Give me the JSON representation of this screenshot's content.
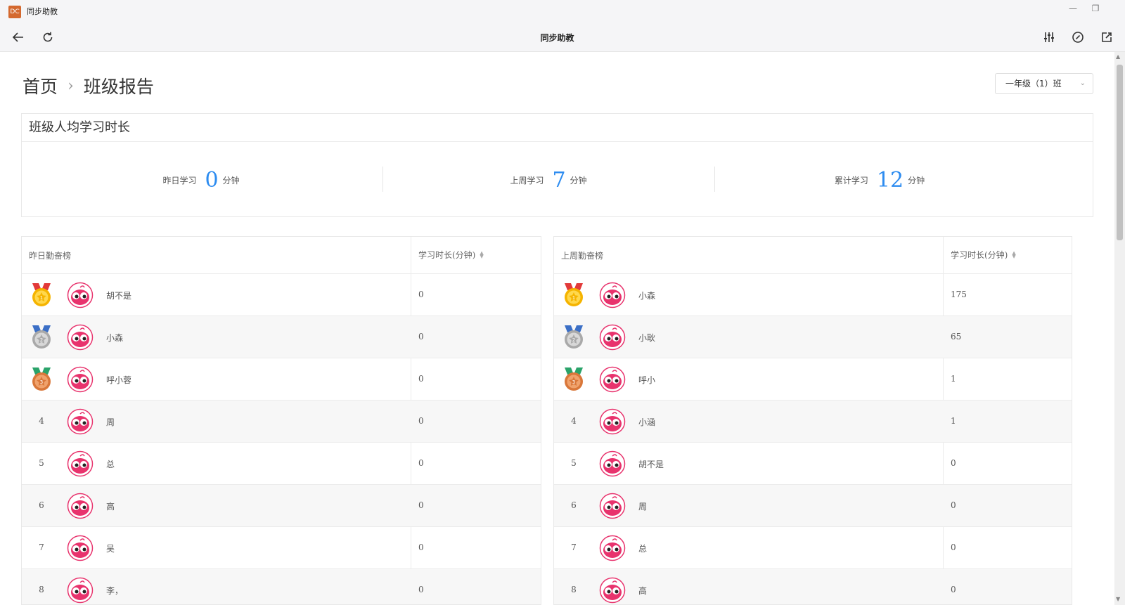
{
  "window": {
    "title": "同步助教",
    "icon_label": "DC",
    "min_label": "—",
    "restore_label": "❐"
  },
  "toolbar": {
    "title": "同步助教"
  },
  "breadcrumb": {
    "home": "首页",
    "separator": "›",
    "current": "班级报告"
  },
  "class_select": {
    "value": "一年级（1）班"
  },
  "stats": {
    "title": "班级人均学习时长",
    "items": [
      {
        "label": "昨日学习",
        "value": "0",
        "unit": "分钟"
      },
      {
        "label": "上周学习",
        "value": "7",
        "unit": "分钟"
      },
      {
        "label": "累计学习",
        "value": "12",
        "unit": "分钟"
      }
    ]
  },
  "yesterday": {
    "title": "昨日勤奋榜",
    "col_label": "学习时长(分钟)",
    "rows": [
      {
        "rank": "1",
        "name": "胡不是",
        "minutes": "0"
      },
      {
        "rank": "2",
        "name": "小森",
        "minutes": "0"
      },
      {
        "rank": "3",
        "name": "呼小蓉",
        "minutes": "0"
      },
      {
        "rank": "4",
        "name": "周",
        "minutes": "0"
      },
      {
        "rank": "5",
        "name": "总",
        "minutes": "0"
      },
      {
        "rank": "6",
        "name": "高",
        "minutes": "0"
      },
      {
        "rank": "7",
        "name": "吴",
        "minutes": "0"
      },
      {
        "rank": "8",
        "name": "李，",
        "minutes": "0"
      }
    ]
  },
  "lastweek": {
    "title": "上周勤奋榜",
    "col_label": "学习时长(分钟)",
    "rows": [
      {
        "rank": "1",
        "name": "小森",
        "minutes": "175"
      },
      {
        "rank": "2",
        "name": "小耿",
        "minutes": "65"
      },
      {
        "rank": "3",
        "name": "呼小",
        "minutes": "1"
      },
      {
        "rank": "4",
        "name": "小涵",
        "minutes": "1"
      },
      {
        "rank": "5",
        "name": "胡不是",
        "minutes": "0"
      },
      {
        "rank": "6",
        "name": "周",
        "minutes": "0"
      },
      {
        "rank": "7",
        "name": "总",
        "minutes": "0"
      },
      {
        "rank": "8",
        "name": "高",
        "minutes": "0"
      }
    ]
  },
  "colors": {
    "accent": "#2d8cf0",
    "gold": "#f5b400",
    "silver": "#a9a9a9",
    "bronze": "#d9773a",
    "avatar": "#e8336d"
  },
  "icons": [
    "back-icon",
    "refresh-icon",
    "settings-sliders-icon",
    "compass-icon",
    "share-icon",
    "medal-icon",
    "avatar-icon",
    "sort-icon",
    "chevron-down-icon"
  ]
}
